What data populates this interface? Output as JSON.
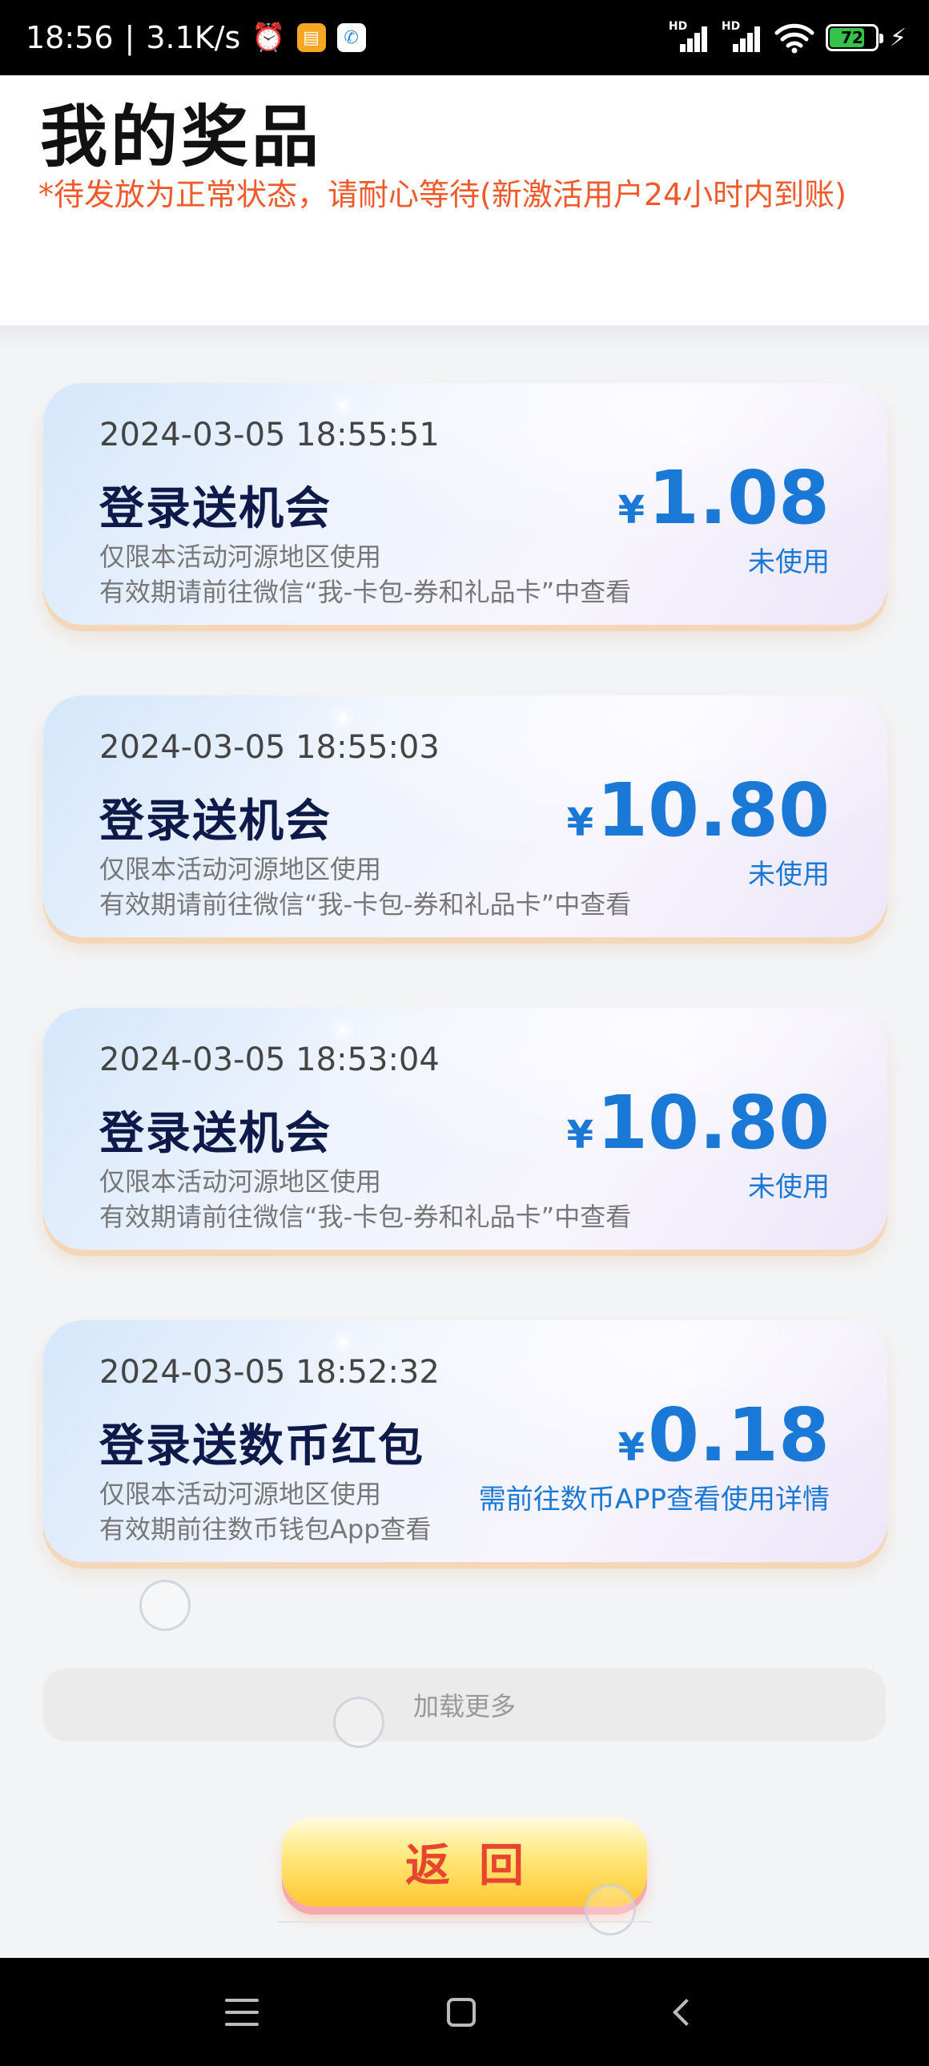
{
  "status_bar": {
    "time": "18:56",
    "speed": "3.1K/s",
    "battery_level": "72",
    "icons": [
      "alarm-icon",
      "notification-app-icon",
      "phone-call-icon",
      "hd-signal-icon",
      "hd-signal-icon",
      "wifi-icon",
      "battery-icon",
      "charging-icon"
    ]
  },
  "header": {
    "title": "我的奖品",
    "notice": "*待发放为正常状态，请耐心等待(新激活用户24小时内到账)"
  },
  "prizes": [
    {
      "time": "2024-03-05 18:55:51",
      "name": "登录送机会",
      "desc1": "仅限本活动河源地区使用",
      "desc2": "有效期请前往微信“我-卡包-券和礼品卡”中查看",
      "currency": "¥",
      "amount": "1.08",
      "status": "未使用"
    },
    {
      "time": "2024-03-05 18:55:03",
      "name": "登录送机会",
      "desc1": "仅限本活动河源地区使用",
      "desc2": "有效期请前往微信“我-卡包-券和礼品卡”中查看",
      "currency": "¥",
      "amount": "10.80",
      "status": "未使用"
    },
    {
      "time": "2024-03-05 18:53:04",
      "name": "登录送机会",
      "desc1": "仅限本活动河源地区使用",
      "desc2": "有效期请前往微信“我-卡包-券和礼品卡”中查看",
      "currency": "¥",
      "amount": "10.80",
      "status": "未使用"
    },
    {
      "time": "2024-03-05 18:52:32",
      "name": "登录送数币红包",
      "desc1": "仅限本活动河源地区使用",
      "desc2": "有效期前往数币钱包App查看",
      "currency": "¥",
      "amount": "0.18",
      "status": "需前往数币APP查看使用详情"
    }
  ],
  "load_more": "加载更多",
  "back_button": "返回",
  "colors": {
    "accent_blue": "#1a78d6",
    "notice_orange": "#f0592a",
    "back_text_red": "#e8452e",
    "button_yellow": "#ffd84a"
  }
}
